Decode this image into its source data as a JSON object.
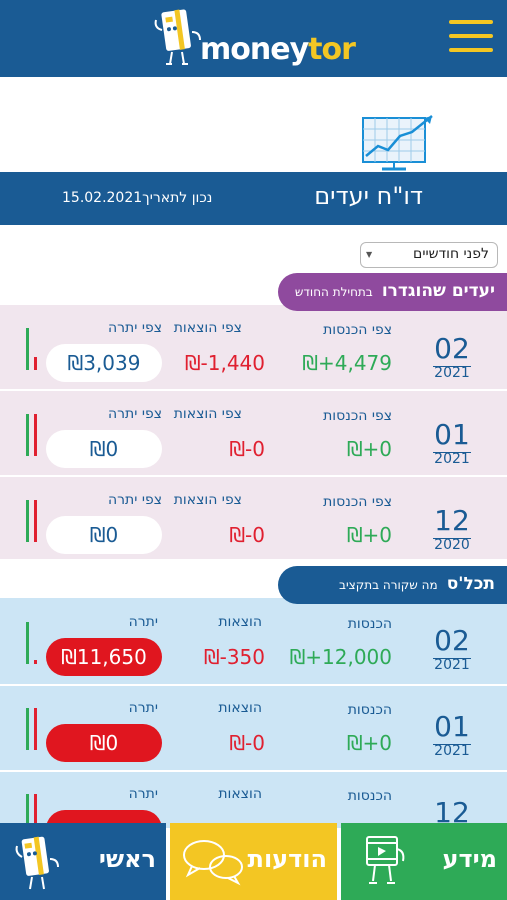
{
  "app": {
    "logo_main": "money",
    "logo_accent": "tor"
  },
  "report": {
    "title": "דו\"ח יעדים",
    "date_text": "15.02.2021נכון לתאריך"
  },
  "period_select": {
    "value": "לפני חודשיים"
  },
  "sections": [
    {
      "title_main": "יעדים שהוגדרו",
      "title_sub": "בתחילת החודש",
      "labels": {
        "income": "צפי הכנסות",
        "expense": "צפי הוצאות",
        "balance": "צפי יתרה"
      },
      "rows": [
        {
          "month": "02",
          "year": "2021",
          "income": "₪+4,479",
          "expense": "₪-1,440",
          "balance": "₪3,039",
          "balance_negative": false,
          "bar_income": 1.0,
          "bar_expense": 0.32
        },
        {
          "month": "01",
          "year": "2021",
          "income": "₪+0",
          "expense": "₪-0",
          "balance": "₪0",
          "balance_negative": false,
          "bar_income": 1.0,
          "bar_expense": 1.0
        },
        {
          "month": "12",
          "year": "2020",
          "income": "₪+0",
          "expense": "₪-0",
          "balance": "₪0",
          "balance_negative": false,
          "bar_income": 1.0,
          "bar_expense": 1.0
        }
      ]
    },
    {
      "title_main": "תכל'ס",
      "title_sub": "מה שקורה בתקציב",
      "labels": {
        "income": "הכנסות",
        "expense": "הוצאות",
        "balance": "יתרה"
      },
      "rows": [
        {
          "month": "02",
          "year": "2021",
          "income": "₪+12,000",
          "expense": "₪-350",
          "balance": "₪11,650",
          "balance_negative": true,
          "bar_income": 1.0,
          "bar_expense": 0.1
        },
        {
          "month": "01",
          "year": "2021",
          "income": "₪+0",
          "expense": "₪-0",
          "balance": "₪0",
          "balance_negative": true,
          "bar_income": 1.0,
          "bar_expense": 1.0
        },
        {
          "month": "12",
          "year": "",
          "income": "",
          "expense": "",
          "balance": "",
          "balance_negative": true,
          "bar_income": 1.0,
          "bar_expense": 1.0
        }
      ]
    }
  ],
  "bottom_nav": {
    "home": "ראשי",
    "messages": "הודעות",
    "info": "מידע"
  },
  "colors": {
    "brand_blue": "#1a5b94",
    "brand_yellow": "#f3c623",
    "purple": "#8f4a9e",
    "green": "#2eaa57",
    "red": "#e02030"
  }
}
